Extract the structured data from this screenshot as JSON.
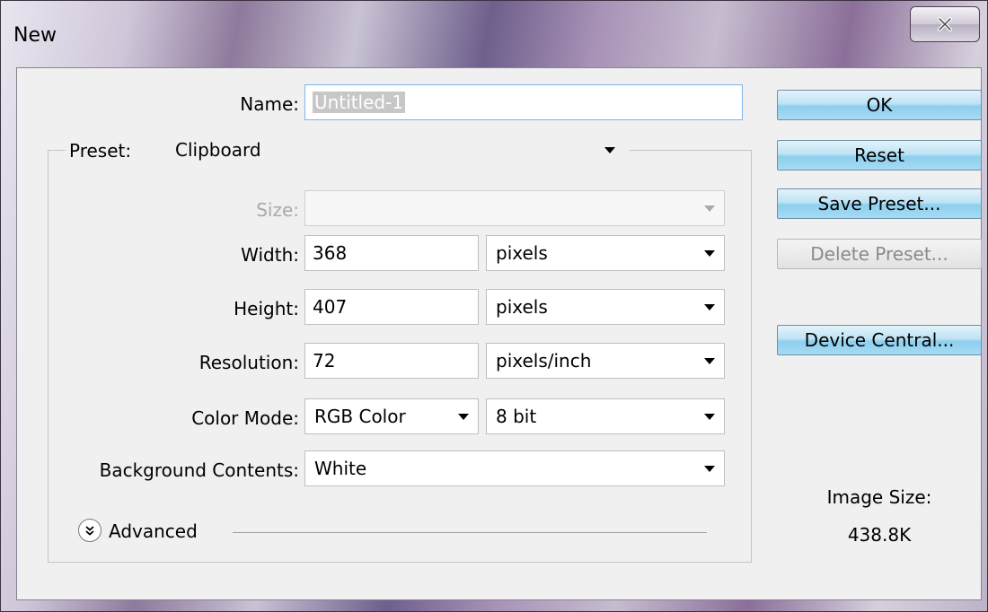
{
  "window": {
    "title": "New"
  },
  "form": {
    "name": {
      "label": "Name:",
      "value": "Untitled-1"
    },
    "preset": {
      "label": "Preset:",
      "value": "Clipboard"
    },
    "size": {
      "label": "Size:",
      "value": ""
    },
    "width": {
      "label": "Width:",
      "value": "368",
      "unit": "pixels"
    },
    "height": {
      "label": "Height:",
      "value": "407",
      "unit": "pixels"
    },
    "resolution": {
      "label": "Resolution:",
      "value": "72",
      "unit": "pixels/inch"
    },
    "color_mode": {
      "label": "Color Mode:",
      "value": "RGB Color",
      "depth": "8 bit"
    },
    "background": {
      "label": "Background Contents:",
      "value": "White"
    },
    "advanced": {
      "label": "Advanced"
    }
  },
  "buttons": {
    "ok": "OK",
    "reset": "Reset",
    "save_preset": "Save Preset...",
    "delete_preset": "Delete Preset...",
    "device_central": "Device Central..."
  },
  "info": {
    "image_size_label": "Image Size:",
    "image_size_value": "438.8K"
  },
  "icons": {
    "close": "close-icon",
    "chevron": "chevron-down-icon",
    "advanced": "double-chevron-icon"
  }
}
